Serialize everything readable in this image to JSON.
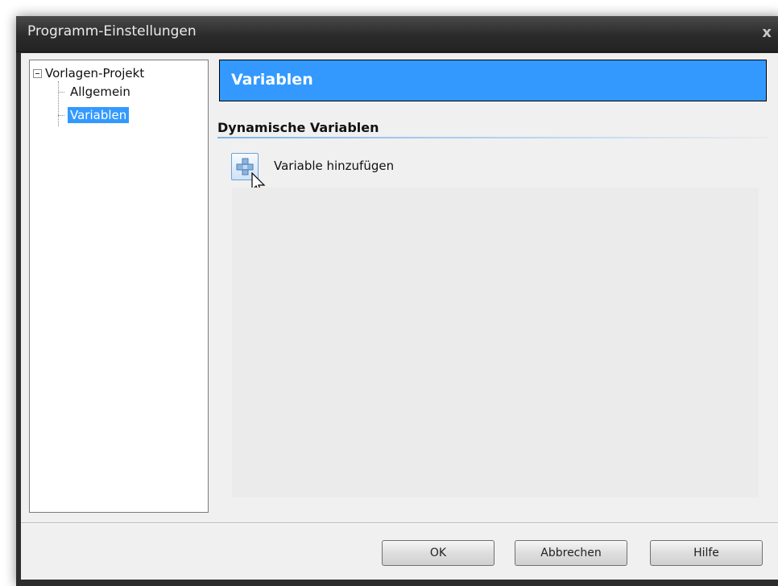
{
  "window": {
    "title": "Programm-Einstellungen",
    "close_glyph": "x"
  },
  "tree": {
    "root": "Vorlagen-Projekt",
    "items": [
      {
        "label": "Allgemein",
        "selected": false
      },
      {
        "label": "Variablen",
        "selected": true
      }
    ]
  },
  "panel": {
    "header": "Variablen",
    "section_title": "Dynamische Variablen",
    "add_label": "Variable hinzufügen"
  },
  "buttons": {
    "ok": "OK",
    "cancel": "Abbrechen",
    "help": "Hilfe"
  },
  "colors": {
    "accent": "#3399ff",
    "titlebar": "#2d2d2d"
  },
  "icons": {
    "add": "plus-icon",
    "close": "close-icon",
    "cursor": "cursor-icon"
  }
}
